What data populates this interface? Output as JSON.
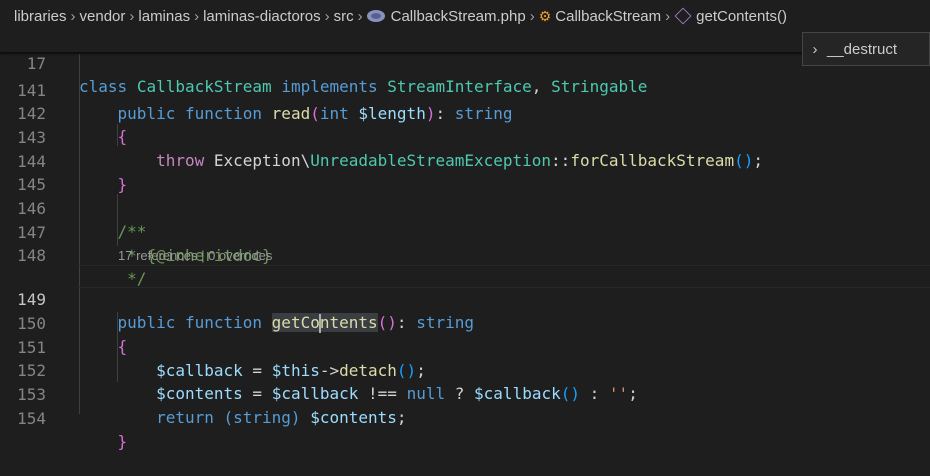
{
  "breadcrumb": {
    "items": [
      "libraries",
      "vendor",
      "laminas",
      "laminas-diactoros",
      "src",
      "CallbackStream.php",
      "CallbackStream",
      "getContents()"
    ],
    "separator": "›"
  },
  "popup": {
    "chevron": "›",
    "label": "__destruct"
  },
  "codelens": "17 references | 0 overrides",
  "lines": {
    "l17": "17",
    "l141": "141",
    "l142": "142",
    "l143": "143",
    "l144": "144",
    "l145": "145",
    "l146": "146",
    "l147": "147",
    "l148": "148",
    "l149": "149",
    "l150": "150",
    "l151": "151",
    "l152": "152",
    "l153": "153",
    "l154": "154"
  },
  "code": {
    "class_kw": "class",
    "class_name": "CallbackStream",
    "implements_kw": "implements",
    "iface1": "StreamInterface",
    "comma": ",",
    "iface2": "Stringable",
    "public": "public",
    "function": "function",
    "read": "read",
    "int": "int",
    "length": "$length",
    "string": "string",
    "throw": "throw",
    "exception": "Exception",
    "backslash": "\\",
    "unreadable": "UnreadableStreamException",
    "dcolon": "::",
    "forcb": "forCallbackStream",
    "doc_open": "/**",
    "doc_star": "*",
    "inheritdoc": "{@inheritdoc}",
    "doc_close": "*/",
    "getcont_a": "getCo",
    "getcont_b": "ntents",
    "callback": "$callback",
    "eq": "=",
    "this": "$this",
    "arrow": "->",
    "detach": "detach",
    "contents": "$contents",
    "neq": "!==",
    "null": "null",
    "q": "?",
    "colon": ":",
    "emptystr": "''",
    "return": "return",
    "cast": "(string)",
    "semi": ";"
  },
  "colors": {
    "background": "#1e1e1e",
    "keyword": "#569cd6",
    "function": "#dcdcaa",
    "type": "#4ec9b0",
    "variable": "#9cdcfe",
    "comment": "#6a9955"
  },
  "icons": [
    "php-file-icon",
    "class-icon",
    "method-icon"
  ]
}
